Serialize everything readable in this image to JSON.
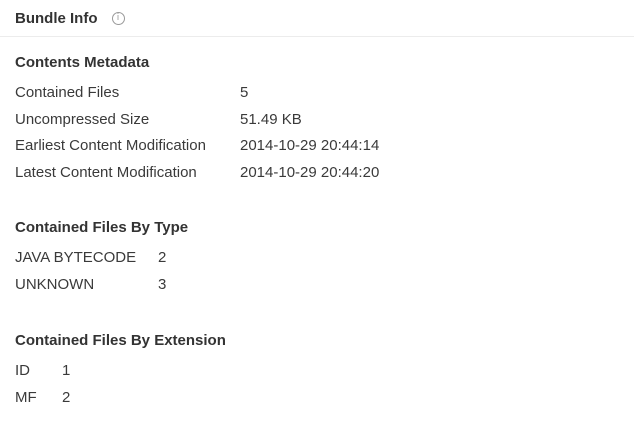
{
  "header": {
    "title": "Bundle Info",
    "info_icon": "info-circle-icon",
    "info_glyph": "i"
  },
  "metadata": {
    "title": "Contents Metadata",
    "rows": [
      {
        "label": "Contained Files",
        "value": "5"
      },
      {
        "label": "Uncompressed Size",
        "value": "51.49 KB"
      },
      {
        "label": "Earliest Content Modification",
        "value": "2014-10-29 20:44:14"
      },
      {
        "label": "Latest Content Modification",
        "value": "2014-10-29 20:44:20"
      }
    ]
  },
  "by_type": {
    "title": "Contained Files By Type",
    "rows": [
      {
        "label": "JAVA BYTECODE",
        "value": "2"
      },
      {
        "label": "UNKNOWN",
        "value": "3"
      }
    ]
  },
  "by_extension": {
    "title": "Contained Files By Extension",
    "rows": [
      {
        "label": "ID",
        "value": "1"
      },
      {
        "label": "MF",
        "value": "2"
      }
    ]
  }
}
